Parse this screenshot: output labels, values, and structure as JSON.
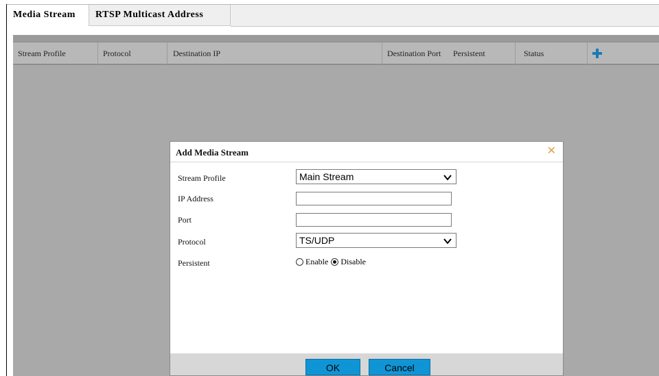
{
  "tabs": [
    {
      "label": "Media Stream",
      "active": true
    },
    {
      "label": "RTSP Multicast Address",
      "active": false
    }
  ],
  "table": {
    "columns": [
      "Stream Profile",
      "Protocol",
      "Destination IP",
      "Destination Port",
      "Persistent",
      "Status"
    ],
    "add_icon": "plus-icon",
    "rows": []
  },
  "dialog": {
    "title": "Add Media Stream",
    "close_icon": "close-icon",
    "fields": {
      "stream_profile_label": "Stream Profile",
      "stream_profile_value": "Main Stream",
      "ip_address_label": "IP Address",
      "ip_address_value": "",
      "port_label": "Port",
      "port_value": "",
      "protocol_label": "Protocol",
      "protocol_value": "TS/UDP",
      "persistent_label": "Persistent",
      "persistent_options": [
        "Enable",
        "Disable"
      ],
      "persistent_selected": "Disable"
    },
    "ok_label": "OK",
    "cancel_label": "Cancel"
  },
  "colors": {
    "accent": "#0f95d6",
    "overlay": "#a9a9a9",
    "close": "#e0a040",
    "plus": "#1a7ab8"
  }
}
